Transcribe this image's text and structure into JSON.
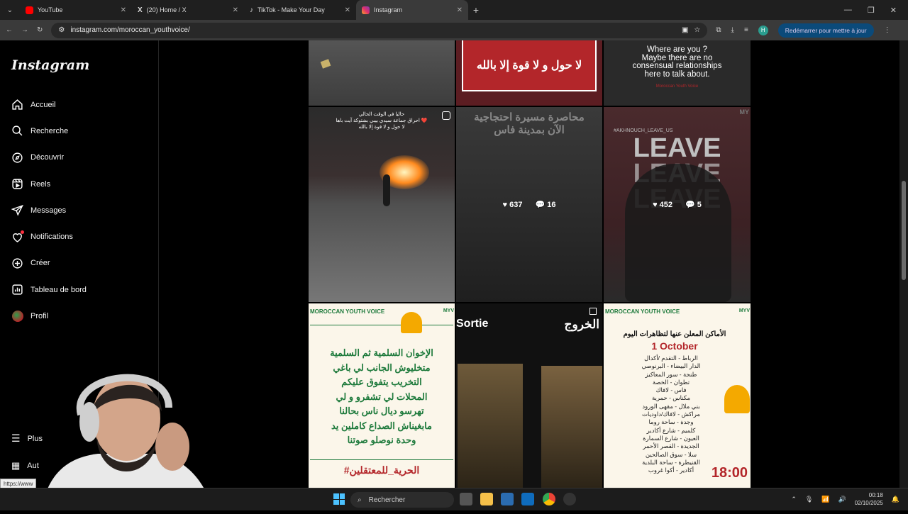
{
  "browser": {
    "tabs": [
      {
        "label": "YouTube",
        "icon": "youtube-icon",
        "color": "#ff0000"
      },
      {
        "label": "(20) Home / X",
        "icon": "x-icon",
        "color": "#ffffff"
      },
      {
        "label": "TikTok - Make Your Day",
        "icon": "tiktok-icon",
        "color": "#ffffff"
      },
      {
        "label": "Instagram",
        "icon": "instagram-icon",
        "color": "#e1306c"
      }
    ],
    "url": "instagram.com/moroccan_youthvoice/",
    "restart_label": "Redémarrer pour mettre à jour",
    "profile_initial": "H"
  },
  "sidebar": {
    "logo": "Instagram",
    "items": [
      {
        "label": "Accueil",
        "icon": "home-icon"
      },
      {
        "label": "Recherche",
        "icon": "search-icon"
      },
      {
        "label": "Découvrir",
        "icon": "compass-icon"
      },
      {
        "label": "Reels",
        "icon": "reels-icon"
      },
      {
        "label": "Messages",
        "icon": "messages-icon"
      },
      {
        "label": "Notifications",
        "icon": "heart-icon"
      },
      {
        "label": "Créer",
        "icon": "plus-square-icon"
      },
      {
        "label": "Tableau de bord",
        "icon": "dashboard-icon"
      },
      {
        "label": "Profil",
        "icon": "profile-avatar"
      }
    ],
    "more_label": "Plus",
    "also_label": "Aut",
    "status_url": "https://www"
  },
  "posts": {
    "row1": {
      "post2_text": "لا حول و لا قوة إلا بالله",
      "post3_text": "Where are you ?\nMaybe there are no\nconsensual relationships\nhere to talk about.",
      "post3_credit": "Moroccan Youth Voice"
    },
    "row2": {
      "post1_caption1": "حاليا في الوقت الحالي",
      "post1_caption2": "احراق جماعة سيدي بيبي بشتوكة آيت باها ❤️",
      "post1_caption3": "لا حول و لا قوة إلا بالله",
      "post2_title1": "محاصرة مسيرة احتجاجية",
      "post2_title2": "الآن بمدينة فاس",
      "post2_likes": "637",
      "post2_comments": "16",
      "post3_hashtag": "#AKHNOUCH_LEAVE_US",
      "post3_leave": "LEAVE",
      "post3_likes": "452",
      "post3_comments": "5",
      "post3_mark": "MY"
    },
    "row3": {
      "post1_header": "MOROCCAN YOUTH VOICE",
      "post1_lines": [
        "الإخوان السلمية ثم السلمية",
        "متخليوش الجانب لي باغي",
        "التخريب يتفوق عليكم",
        "المحلات لي تشفرو و لي",
        "تهرسو ديال ناس بحالنا",
        "مابغيناش الصداع كاملين يد",
        "وحدة نوصلو صوتنا"
      ],
      "post1_footer": "#الحرية_للمعتقلين",
      "post1_mark": "MYV",
      "post2_left": "Sortie",
      "post2_right": "الخروج",
      "post3_header": "MOROCCAN YOUTH VOICE",
      "post3_title": "الأماكن المعلن عنها لتظاهرات اليوم",
      "post3_date": "1 October",
      "post3_places": [
        "الرباط - التقدم /أكدال",
        "الدار البيضاء - البرنوصي",
        "طنجة - سور المعاكيز",
        "تطوان - الخصة",
        "فاس - لافاك",
        "مكناس - حمرية",
        "بني ملال - مقهى الورود",
        "مراكش - لافاك/داوديات",
        "وجدة - ساحة روما",
        "كلميم - شارع أكادير",
        "العيون - شارع السمارة",
        "الجديدة - القصر الأحمر",
        "سلا - سوق الصالحين",
        "القنيطرة - ساحة البلدية",
        "أكادير - أكوا غروب"
      ],
      "post3_time": "18:00",
      "post3_mark": "MYV"
    }
  },
  "taskbar": {
    "search_label": "Rechercher",
    "time": "00:18",
    "date": "02/10/2025"
  },
  "colors": {
    "accent_red": "#b3262a",
    "ig_bg": "#000000",
    "poster_cream": "#fbf6ea",
    "poster_green": "#1e7a3c"
  }
}
